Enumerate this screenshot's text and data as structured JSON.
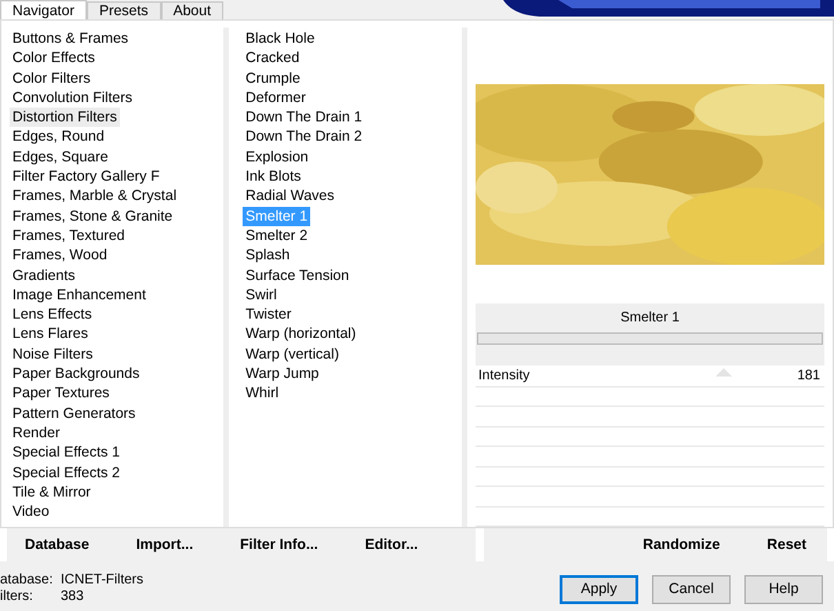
{
  "tabs": [
    {
      "label": "Navigator",
      "selected": true
    },
    {
      "label": "Presets",
      "selected": false
    },
    {
      "label": "About",
      "selected": false
    }
  ],
  "categories": [
    {
      "label": "Buttons & Frames",
      "selected": false
    },
    {
      "label": "Color Effects",
      "selected": false
    },
    {
      "label": "Color Filters",
      "selected": false
    },
    {
      "label": "Convolution Filters",
      "selected": false
    },
    {
      "label": "Distortion Filters",
      "selected": true
    },
    {
      "label": "Edges, Round",
      "selected": false
    },
    {
      "label": "Edges, Square",
      "selected": false
    },
    {
      "label": "Filter Factory Gallery F",
      "selected": false
    },
    {
      "label": "Frames, Marble & Crystal",
      "selected": false
    },
    {
      "label": "Frames, Stone & Granite",
      "selected": false
    },
    {
      "label": "Frames, Textured",
      "selected": false
    },
    {
      "label": "Frames, Wood",
      "selected": false
    },
    {
      "label": "Gradients",
      "selected": false
    },
    {
      "label": "Image Enhancement",
      "selected": false
    },
    {
      "label": "Lens Effects",
      "selected": false
    },
    {
      "label": "Lens Flares",
      "selected": false
    },
    {
      "label": "Noise Filters",
      "selected": false
    },
    {
      "label": "Paper Backgrounds",
      "selected": false
    },
    {
      "label": "Paper Textures",
      "selected": false
    },
    {
      "label": "Pattern Generators",
      "selected": false
    },
    {
      "label": "Render",
      "selected": false
    },
    {
      "label": "Special Effects 1",
      "selected": false
    },
    {
      "label": "Special Effects 2",
      "selected": false
    },
    {
      "label": "Tile & Mirror",
      "selected": false
    },
    {
      "label": "Video",
      "selected": false
    }
  ],
  "filters": [
    {
      "label": "Black Hole",
      "selected": false
    },
    {
      "label": "Cracked",
      "selected": false
    },
    {
      "label": "Crumple",
      "selected": false
    },
    {
      "label": "Deformer",
      "selected": false
    },
    {
      "label": "Down The Drain 1",
      "selected": false
    },
    {
      "label": "Down The Drain 2",
      "selected": false
    },
    {
      "label": "Explosion",
      "selected": false
    },
    {
      "label": "Ink Blots",
      "selected": false
    },
    {
      "label": "Radial Waves",
      "selected": false
    },
    {
      "label": "Smelter 1",
      "selected": true
    },
    {
      "label": "Smelter 2",
      "selected": false
    },
    {
      "label": "Splash",
      "selected": false
    },
    {
      "label": "Surface Tension",
      "selected": false
    },
    {
      "label": "Swirl",
      "selected": false
    },
    {
      "label": "Twister",
      "selected": false
    },
    {
      "label": "Warp (horizontal)",
      "selected": false
    },
    {
      "label": "Warp (vertical)",
      "selected": false
    },
    {
      "label": "Warp Jump",
      "selected": false
    },
    {
      "label": "Whirl",
      "selected": false
    }
  ],
  "preview": {
    "kind": "picture"
  },
  "filter_title": "Smelter 1",
  "progress": {
    "level": 0
  },
  "controls": [
    {
      "label": "Intensity",
      "value": "181",
      "level": 0.71
    }
  ],
  "left_buttons": [
    "Database",
    "Import...",
    "Filter Info...",
    "Editor..."
  ],
  "right_buttons": [
    "Randomize",
    "Reset"
  ],
  "status": [
    {
      "label": "atabase:",
      "value": "ICNET-Filters"
    },
    {
      "label": "ilters:",
      "value": "383"
    }
  ],
  "dialog_buttons": [
    {
      "label": "Apply",
      "selected": true
    },
    {
      "label": "Cancel",
      "selected": false
    },
    {
      "label": "Help",
      "selected": false
    }
  ]
}
